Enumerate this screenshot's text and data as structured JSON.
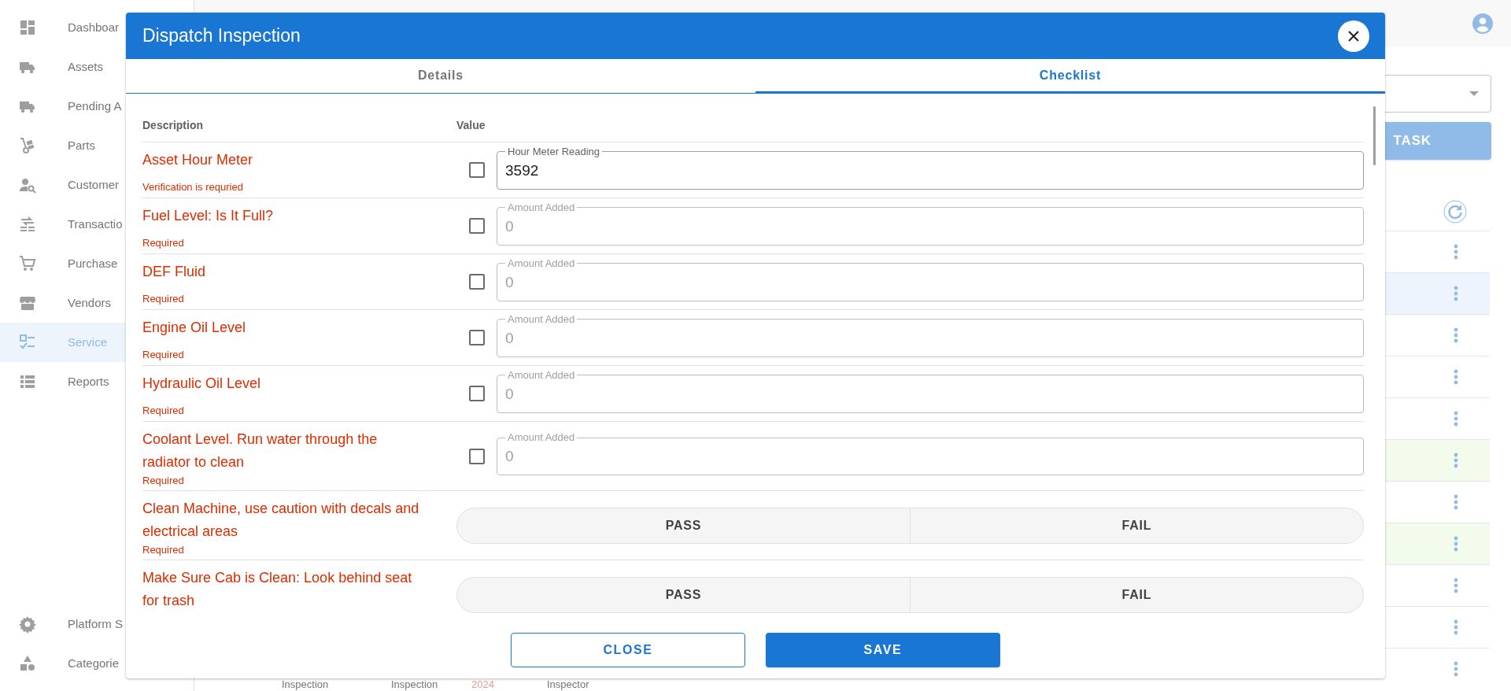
{
  "sidebar": {
    "items": [
      {
        "label": "Dashboar",
        "selected": false
      },
      {
        "label": "Assets",
        "selected": false
      },
      {
        "label": "Pending A",
        "selected": false
      },
      {
        "label": "Parts",
        "selected": false
      },
      {
        "label": "Customer",
        "selected": false
      },
      {
        "label": "Transactio",
        "selected": false
      },
      {
        "label": "Purchase",
        "selected": false
      },
      {
        "label": "Vendors",
        "selected": false
      },
      {
        "label": "Service",
        "selected": true
      },
      {
        "label": "Reports",
        "selected": false
      }
    ],
    "footer_items": [
      {
        "label": "Platform S",
        "selected": false
      },
      {
        "label": "Categorie",
        "selected": false
      }
    ]
  },
  "background_page": {
    "task_button": "TASK",
    "table_rows": [
      {
        "color": "#ffffff"
      },
      {
        "color": "#edf4fd"
      },
      {
        "color": "#ffffff"
      },
      {
        "color": "#ffffff"
      },
      {
        "color": "#ffffff"
      },
      {
        "color": "#f3fbec"
      },
      {
        "color": "#ffffff"
      },
      {
        "color": "#f3fbec"
      },
      {
        "color": "#ffffff"
      },
      {
        "color": "#ffffff"
      },
      {
        "color": "#ffffff"
      }
    ],
    "bottom_cells": [
      {
        "text": "Inspection",
        "color": "#757575"
      },
      {
        "text": "Inspection",
        "color": "#757575"
      },
      {
        "text": "2024",
        "color": "#ef9a9a"
      },
      {
        "text": "Inspector",
        "color": "#757575"
      }
    ]
  },
  "dialog": {
    "title": "Dispatch Inspection",
    "tabs": [
      {
        "label": "Details",
        "selected": false
      },
      {
        "label": "Checklist",
        "selected": true
      }
    ],
    "columns": [
      "Description",
      "Value"
    ],
    "rows": [
      {
        "kind": "measure",
        "title": "Asset Hour Meter",
        "note": "Verification is requried",
        "checked": false,
        "field": {
          "label": "Hour Meter Reading",
          "value": "3592",
          "disabled": false
        }
      },
      {
        "kind": "measure",
        "title": "Fuel Level: Is It Full?",
        "note": "Required",
        "checked": false,
        "field": {
          "label": "Amount Added",
          "value": "0",
          "disabled": true
        }
      },
      {
        "kind": "measure",
        "title": "DEF Fluid",
        "note": "Required",
        "checked": false,
        "field": {
          "label": "Amount Added",
          "value": "0",
          "disabled": true
        }
      },
      {
        "kind": "measure",
        "title": "Engine Oil Level",
        "note": "Required",
        "checked": false,
        "field": {
          "label": "Amount Added",
          "value": "0",
          "disabled": true
        }
      },
      {
        "kind": "measure",
        "title": "Hydraulic Oil Level",
        "note": "Required",
        "checked": false,
        "field": {
          "label": "Amount Added",
          "value": "0",
          "disabled": true
        }
      },
      {
        "kind": "measure",
        "title": "Coolant Level. Run water through the radiator to clean",
        "note": "Required",
        "checked": false,
        "field": {
          "label": "Amount Added",
          "value": "0",
          "disabled": true
        }
      },
      {
        "kind": "pass_fail",
        "title": "Clean Machine, use caution with decals and electrical areas",
        "note": "Required",
        "options": [
          {
            "label": "PASS",
            "selected": false
          },
          {
            "label": "FAIL",
            "selected": false
          }
        ]
      },
      {
        "kind": "pass_fail",
        "title": "Make Sure Cab is Clean: Look behind seat for trash",
        "options": [
          {
            "label": "PASS",
            "selected": false
          },
          {
            "label": "FAIL",
            "selected": false
          }
        ]
      }
    ],
    "buttons": [
      {
        "label": "CLOSE",
        "kind": "outlined"
      },
      {
        "label": "SAVE",
        "kind": "filled"
      }
    ]
  }
}
